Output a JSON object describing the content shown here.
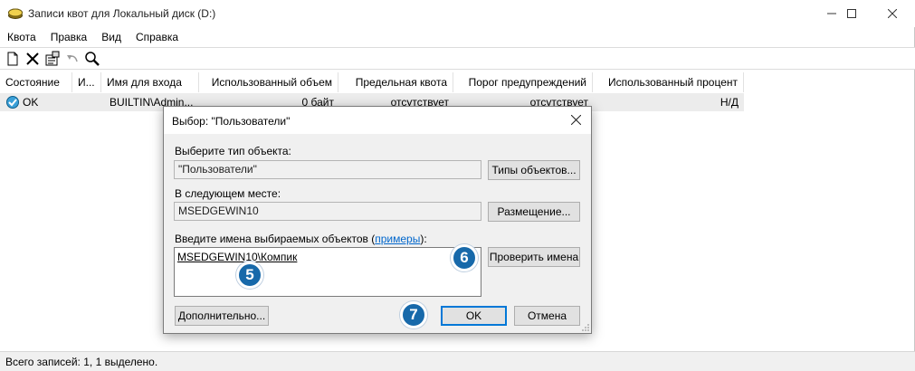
{
  "window": {
    "title": "Записи квот для Локальный диск (D:)",
    "minimize": "—",
    "maximize": "☐",
    "close": "✕"
  },
  "menu": [
    "Квота",
    "Правка",
    "Вид",
    "Справка"
  ],
  "toolbar": {
    "icons": [
      "new-entry-icon",
      "delete-icon",
      "properties-icon",
      "undo-icon",
      "find-icon"
    ]
  },
  "table": {
    "headers": [
      "Состояние",
      "И...",
      "Имя для входа",
      "Использованный объем",
      "Предельная квота",
      "Порог предупреждений",
      "Использованный процент"
    ],
    "rows": [
      [
        "OK",
        "",
        "BUILTIN\\Admin...",
        "0 байт",
        "отсутствует",
        "отсутствует",
        "Н/Д"
      ]
    ]
  },
  "status": {
    "text": "Всего записей: 1, 1 выделено."
  },
  "dialog": {
    "title": "Выбор: \"Пользователи\"",
    "close": "✕",
    "object_type_label": "Выберите тип объекта:",
    "object_type_value": "\"Пользователи\"",
    "object_types_button": "Типы объектов...",
    "location_label": "В следующем месте:",
    "location_value": "MSEDGEWIN10",
    "location_button": "Размещение...",
    "names_label_prefix": "Введите имена выбираемых объектов (",
    "names_label_link": "примеры",
    "names_label_suffix": "):",
    "names_value": "MSEDGEWIN10\\Компик",
    "check_names_button": "Проверить имена",
    "advanced_button": "Дополнительно...",
    "ok_button": "OK",
    "cancel_button": "Отмена"
  },
  "annotations": {
    "step5": "5",
    "step6": "6",
    "step7": "7"
  },
  "colors": {
    "badge": "#1769aa",
    "link": "#0066cc",
    "focus": "#0078d7"
  }
}
